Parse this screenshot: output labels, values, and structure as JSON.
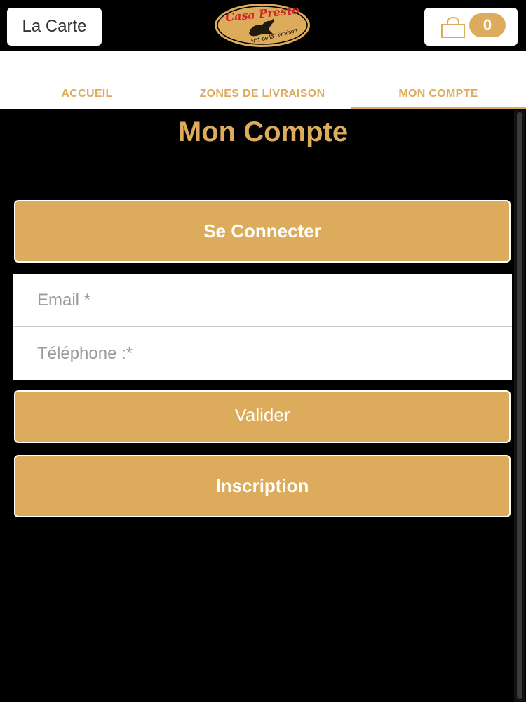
{
  "header": {
    "menu_label": "La Carte",
    "logo": {
      "name": "Casa Presto",
      "tagline": "N°1 de la Livraison"
    },
    "cart": {
      "count": "0"
    }
  },
  "nav": {
    "tabs": [
      {
        "label": "ACCUEIL",
        "active": false
      },
      {
        "label": "ZONES DE LIVRAISON",
        "active": false
      },
      {
        "label": "MON COMPTE",
        "active": true
      }
    ]
  },
  "account": {
    "title": "Mon Compte",
    "login_button": "Se Connecter",
    "email_placeholder": "Email *",
    "phone_placeholder": "Téléphone :*",
    "validate_button": "Valider",
    "signup_button": "Inscription"
  },
  "colors": {
    "accent": "#dcac5c",
    "background": "#000000",
    "logo_red": "#d0232a"
  }
}
